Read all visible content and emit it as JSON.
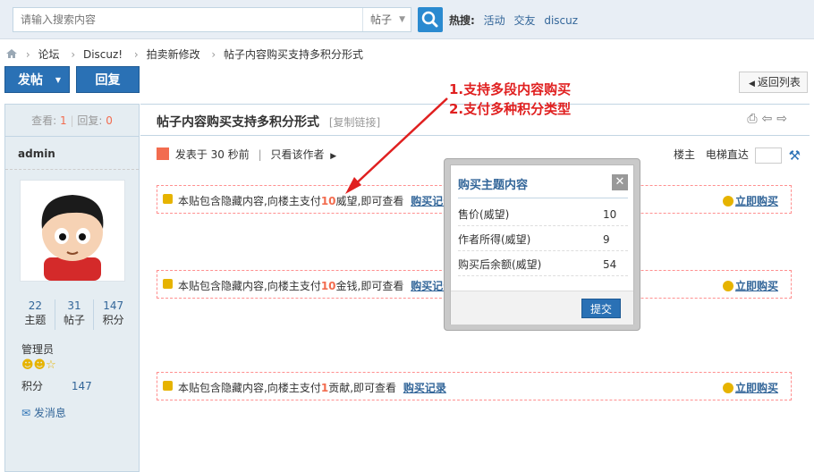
{
  "search": {
    "placeholder": "请输入搜索内容",
    "type": "帖子",
    "hot_label": "热搜:",
    "hot_links": [
      "活动",
      "交友",
      "discuz"
    ]
  },
  "breadcrumb": [
    "论坛",
    "Discuz!",
    "拍卖新修改",
    "帖子内容购买支持多积分形式"
  ],
  "toolbar": {
    "post_label": "发帖",
    "reply_label": "回复",
    "back_label": "返回列表"
  },
  "thread": {
    "views_label": "查看:",
    "views": "1",
    "replies_label": "回复:",
    "replies": "0",
    "title": "帖子内容购买支持多积分形式",
    "copy_link": "[复制链接]"
  },
  "author": {
    "name": "admin",
    "counts": [
      {
        "value": "22",
        "label": "主题"
      },
      {
        "value": "31",
        "label": "帖子"
      },
      {
        "value": "147",
        "label": "积分"
      }
    ],
    "group": "管理员",
    "credit_label": "积分",
    "credit_value": "147",
    "pm_label": "发消息"
  },
  "post_meta": {
    "posted": "发表于 30 秒前",
    "only_author": "只看该作者",
    "floor": "楼主",
    "elevator": "电梯直达"
  },
  "annotation": {
    "line1": "1.支持多段内容购买",
    "line2": "2.支付多种积分类型"
  },
  "locked_blocks": [
    {
      "pre": "本贴包含隐藏内容,向楼主支付",
      "amount": "10",
      "post": "威望,即可查看",
      "record": "购买记录",
      "buy": "立即购买"
    },
    {
      "pre": "本贴包含隐藏内容,向楼主支付",
      "amount": "10",
      "post": "金钱,即可查看",
      "record": "购买记录",
      "buy": "立即购买"
    },
    {
      "pre": "本贴包含隐藏内容,向楼主支付",
      "amount": "1",
      "post": "贡献,即可查看",
      "record": "购买记录",
      "buy": "立即购买"
    }
  ],
  "popup": {
    "title": "购买主题内容",
    "rows": [
      {
        "label": "售价(威望)",
        "value": "10"
      },
      {
        "label": "作者所得(威望)",
        "value": "9"
      },
      {
        "label": "购买后余额(威望)",
        "value": "54"
      }
    ],
    "submit_label": "提交"
  },
  "colors": {
    "accent": "#2a71b5",
    "link": "#336699",
    "highlight": "#f26c4f",
    "annotation": "#e02020"
  }
}
